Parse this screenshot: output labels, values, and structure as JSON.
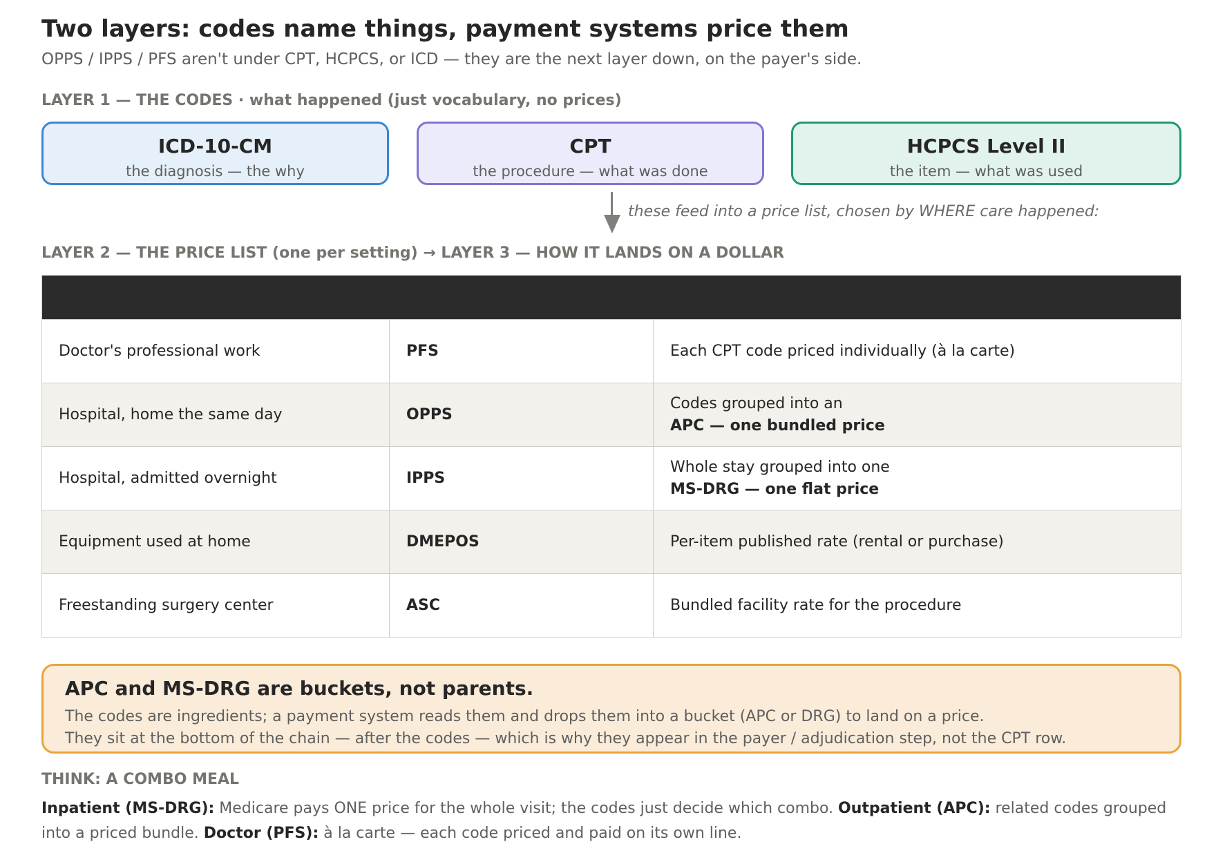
{
  "title": "Two layers: codes name things, payment systems price them",
  "subtitle": "OPPS / IPPS / PFS aren't under CPT, HCPCS, or ICD — they are the next layer down, on the payer's side.",
  "layer1_label": "LAYER 1 — THE CODES · what happened (just vocabulary, no prices)",
  "codes": [
    {
      "name": "ICD-10-CM",
      "desc": "the diagnosis — the why",
      "color": "#3b87d3",
      "fill": "#e5f0fa"
    },
    {
      "name": "CPT",
      "desc": "the procedure — what was done",
      "color": "#8173d2",
      "fill": "#ecebfb"
    },
    {
      "name": "HCPCS Level II",
      "desc": "the item — what was used",
      "color": "#1f9a70",
      "fill": "#e1f3ec"
    }
  ],
  "arrow_note": "these feed into a price list, chosen by WHERE care happened:",
  "layer2_label": "LAYER 2 — THE PRICE LIST (one per setting) → LAYER 3 — HOW IT LANDS ON A DOLLAR",
  "rows": [
    {
      "setting": "Doctor's professional work",
      "system": "PFS",
      "how": "Each CPT code priced individually (à la carte)",
      "how_bold": ""
    },
    {
      "setting": "Hospital, home the same day",
      "system": "OPPS",
      "how": "Codes grouped into an",
      "how_bold": "APC — one bundled price"
    },
    {
      "setting": "Hospital, admitted overnight",
      "system": "IPPS",
      "how": "Whole stay grouped into one",
      "how_bold": "MS-DRG — one flat price"
    },
    {
      "setting": "Equipment used at home",
      "system": "DMEPOS",
      "how": "Per-item published rate (rental or purchase)",
      "how_bold": ""
    },
    {
      "setting": "Freestanding surgery center",
      "system": "ASC",
      "how": "Bundled facility rate for the procedure",
      "how_bold": ""
    }
  ],
  "callout": {
    "heading": "APC and MS-DRG are buckets, not parents.",
    "line1": "The codes are ingredients; a payment system reads them and drops them into a bucket (APC or DRG) to land on a price.",
    "line2": "They sit at the bottom of the chain — after the codes — which is why they appear in the payer / adjudication step, not the CPT row."
  },
  "think": {
    "label": "THINK: A COMBO MEAL",
    "inpatient_term": "Inpatient (MS-DRG):",
    "inpatient_text": " Medicare pays ONE price for the whole visit; the codes just decide which combo. ",
    "outpatient_term": "Outpatient (APC):",
    "outpatient_text": " related codes grouped into a priced bundle. ",
    "doctor_term": "Doctor (PFS):",
    "doctor_text": " à la carte — each code priced and paid on its own line."
  }
}
